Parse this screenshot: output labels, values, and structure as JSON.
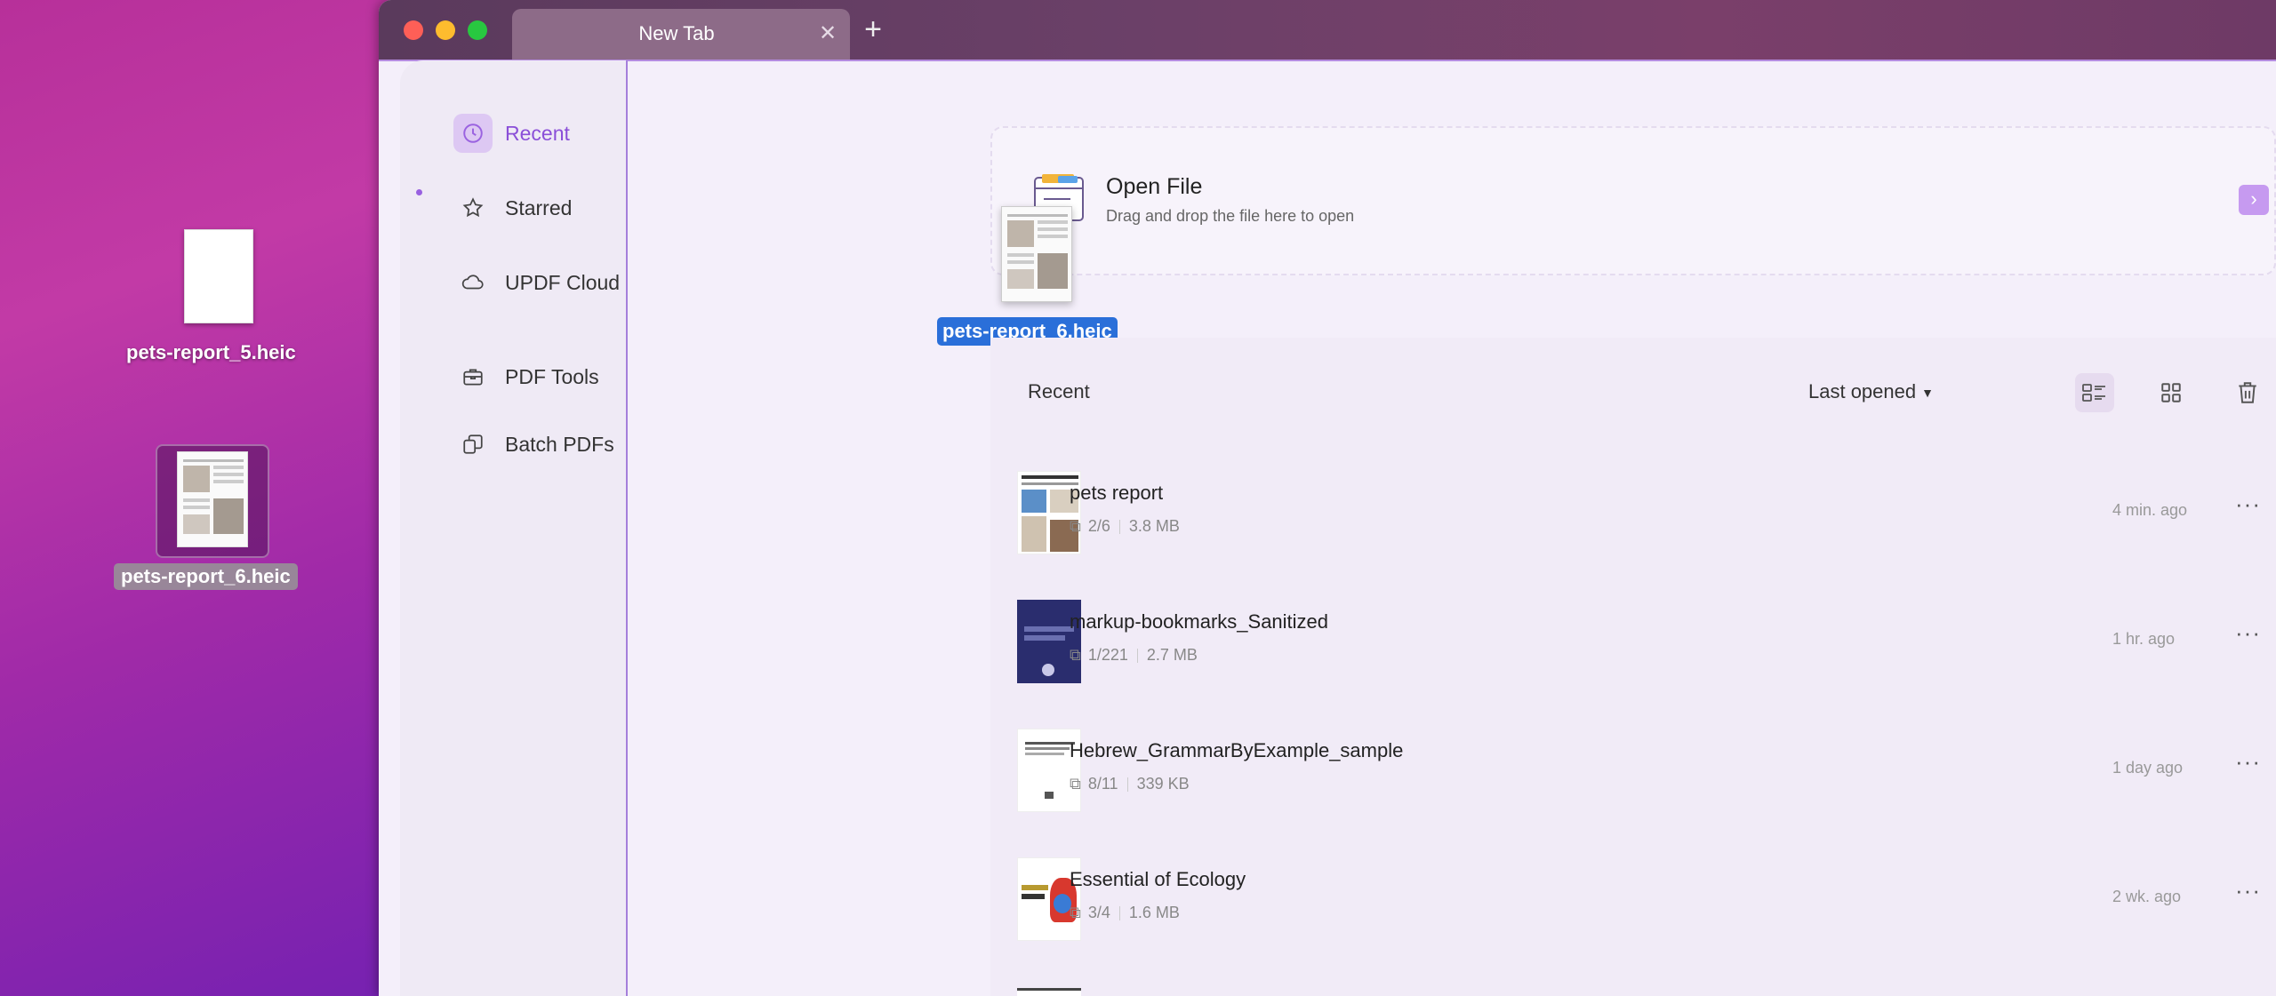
{
  "desktop": {
    "files": [
      {
        "label": "pets-report_5.heic"
      },
      {
        "label": "pets-report_6.heic"
      }
    ]
  },
  "window": {
    "tab_title": "New Tab",
    "tab_close": "✕",
    "new_tab": "+"
  },
  "sidebar": {
    "items": [
      {
        "label": "Recent",
        "icon": "clock-icon"
      },
      {
        "label": "Starred",
        "icon": "star-icon"
      },
      {
        "label": "UPDF Cloud",
        "icon": "cloud-icon"
      },
      {
        "label": "PDF Tools",
        "icon": "briefcase-icon"
      },
      {
        "label": "Batch PDFs",
        "icon": "batch-icon"
      }
    ]
  },
  "open_file": {
    "title": "Open File",
    "subtitle": "Drag and drop the file here to open",
    "drag_label": "pets-report_6.heic"
  },
  "recent": {
    "heading": "Recent",
    "sort_label": "Last opened",
    "files": [
      {
        "name": "pets report",
        "pages": "2/6",
        "size": "3.8 MB",
        "time": "4 min. ago"
      },
      {
        "name": "markup-bookmarks_Sanitized",
        "pages": "1/221",
        "size": "2.7 MB",
        "time": "1 hr. ago"
      },
      {
        "name": "Hebrew_GrammarByExample_sample",
        "pages": "8/11",
        "size": "339 KB",
        "time": "1 day ago"
      },
      {
        "name": "Essential of Ecology",
        "pages": "3/4",
        "size": "1.6 MB",
        "time": "2 wk. ago"
      }
    ]
  },
  "colors": {
    "accent": "#8b4fd8",
    "drag_highlight": "#2a6fd9"
  }
}
